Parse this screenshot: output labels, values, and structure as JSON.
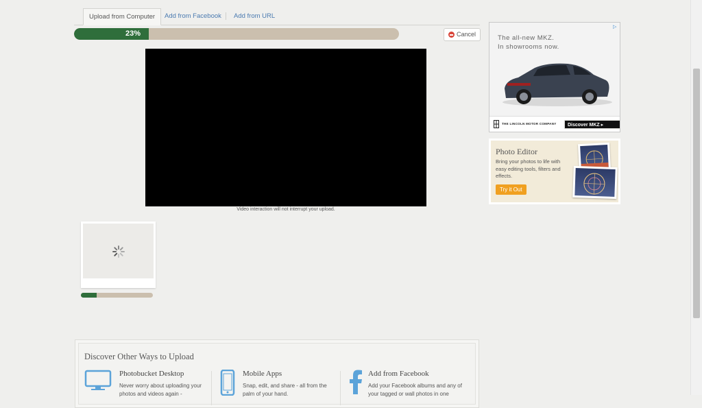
{
  "tabs": [
    {
      "label": "Upload from Computer",
      "active": true
    },
    {
      "label": "Add from Facebook",
      "active": false
    },
    {
      "label": "Add from URL",
      "active": false
    }
  ],
  "upload": {
    "progress_label": "23%",
    "progress": 0.23,
    "cancel_label": "Cancel",
    "video_note": "Video interaction will not interrupt your upload.",
    "thumb_progress": 0.22
  },
  "ads": {
    "mkz": {
      "line1": "The all-new MKZ.",
      "line2": "In showrooms now.",
      "brand": "THE LINCOLN MOTOR COMPANY",
      "cta": "Discover MKZ ▸"
    },
    "photo_editor": {
      "title": "Photo Editor",
      "description": "Bring your photos to life with easy editing tools, filters and effects.",
      "cta": "Try it Out"
    }
  },
  "discover": {
    "heading": "Discover Other Ways to Upload",
    "items": [
      {
        "title": "Photobucket Desktop",
        "description": "Never worry about uploading your photos and videos again -",
        "icon": "monitor-icon"
      },
      {
        "title": "Mobile Apps",
        "description": "Snap, edit, and share - all from the palm of your hand.",
        "icon": "phone-icon"
      },
      {
        "title": "Add from Facebook",
        "description": "Add your Facebook albums and any of your tagged or wall photos in one",
        "icon": "facebook-icon"
      }
    ]
  },
  "colors": {
    "progress_fill": "#2f6e3b",
    "progress_track": "#cbbfae",
    "link": "#4a7ab0",
    "icon_blue": "#5ba3d9"
  }
}
